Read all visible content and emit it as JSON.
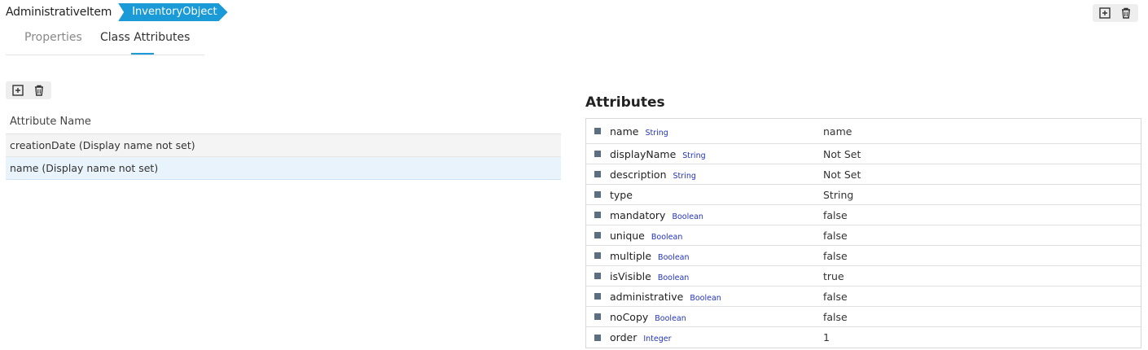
{
  "header": {
    "class_name": "AdministrativeItem",
    "parent_class": "InventoryObject"
  },
  "tabs": [
    {
      "label": "Properties",
      "active": false
    },
    {
      "label": "Class Attributes",
      "active": true
    }
  ],
  "attribute_list": {
    "column_header": "Attribute Name",
    "rows": [
      {
        "label": "creationDate (Display name not set)",
        "selected": false
      },
      {
        "label": "name (Display name not set)",
        "selected": true
      }
    ]
  },
  "attributes_panel": {
    "title": "Attributes",
    "properties": [
      {
        "name": "name",
        "type": "String",
        "value": "name"
      },
      {
        "name": "displayName",
        "type": "String",
        "value": "Not Set"
      },
      {
        "name": "description",
        "type": "String",
        "value": "Not Set"
      },
      {
        "name": "type",
        "type": "",
        "value": "String"
      },
      {
        "name": "mandatory",
        "type": "Boolean",
        "value": "false"
      },
      {
        "name": "unique",
        "type": "Boolean",
        "value": "false"
      },
      {
        "name": "multiple",
        "type": "Boolean",
        "value": "false"
      },
      {
        "name": "isVisible",
        "type": "Boolean",
        "value": "true"
      },
      {
        "name": "administrative",
        "type": "Boolean",
        "value": "false"
      },
      {
        "name": "noCopy",
        "type": "Boolean",
        "value": "false"
      },
      {
        "name": "order",
        "type": "Integer",
        "value": "1"
      }
    ]
  },
  "icons": {
    "add": "add-box-icon",
    "delete": "trash-icon"
  },
  "colors": {
    "accent": "#1a9ad6",
    "type_label": "#2233bb",
    "selected_row": "#e9f3fb"
  }
}
